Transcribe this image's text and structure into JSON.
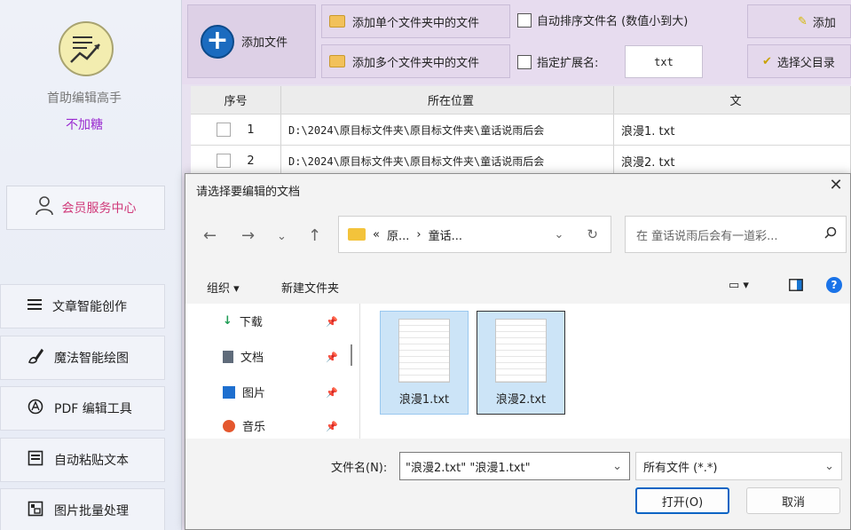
{
  "sidebar": {
    "app_name": "首助编辑高手",
    "app_sub": "不加糖",
    "member": "会员服务中心",
    "nav": [
      "文章智能创作",
      "魔法智能绘图",
      "PDF 编辑工具",
      "自动粘贴文本",
      "图片批量处理"
    ]
  },
  "toolbar": {
    "add_file": "添加文件",
    "add_single_folder": "添加单个文件夹中的文件",
    "add_multi_folder": "添加多个文件夹中的文件",
    "auto_sort": "自动排序文件名 (数值小到大)",
    "specify_ext": "指定扩展名:",
    "ext_value": "txt",
    "add_more": "添加",
    "choose_parent": "选择父目录"
  },
  "table": {
    "headers": [
      "序号",
      "所在位置",
      "文"
    ],
    "rows": [
      {
        "no": "1",
        "path": "D:\\2024\\原目标文件夹\\原目标文件夹\\童话说雨后会",
        "name": "浪漫1. txt"
      },
      {
        "no": "2",
        "path": "D:\\2024\\原目标文件夹\\原目标文件夹\\童话说雨后会",
        "name": "浪漫2. txt"
      }
    ]
  },
  "dialog": {
    "title": "请选择要编辑的文档",
    "address_prefix": "«",
    "address_part1": "原...",
    "address_sep": "›",
    "address_part2": "童话...",
    "search_placeholder": "在 童话说雨后会有一道彩...",
    "organize": "组织 ▾",
    "new_folder": "新建文件夹",
    "tree": [
      "下载",
      "文档",
      "图片",
      "音乐"
    ],
    "files": [
      "浪漫1.txt",
      "浪漫2.txt"
    ],
    "filename_label": "文件名(N):",
    "filename_value": "\"浪漫2.txt\" \"浪漫1.txt\"",
    "filter_value": "所有文件 (*.*)",
    "open": "打开(O)",
    "cancel": "取消"
  }
}
